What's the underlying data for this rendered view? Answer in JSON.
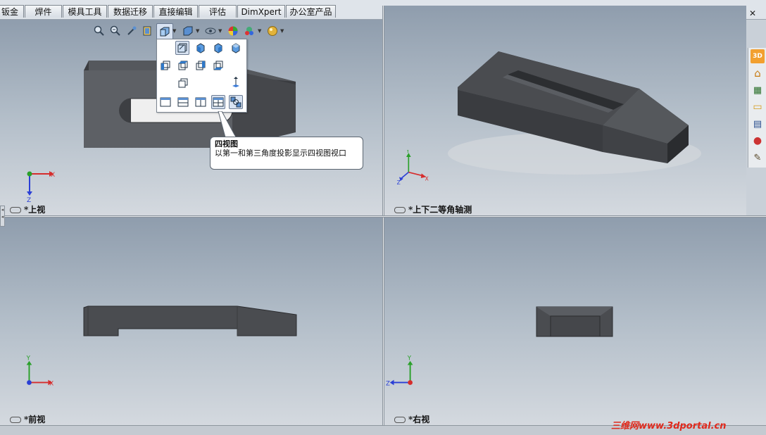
{
  "tabs": [
    {
      "label": "钣金"
    },
    {
      "label": "焊件"
    },
    {
      "label": "模具工具"
    },
    {
      "label": "数据迁移"
    },
    {
      "label": "直接编辑"
    },
    {
      "label": "评估"
    },
    {
      "label": "DimXpert"
    },
    {
      "label": "办公室产品"
    }
  ],
  "window_controls": {
    "minimize": "–",
    "restore": "❐",
    "close": "✕"
  },
  "heads_up_toolbar": [
    {
      "name": "zoom-to-fit-icon",
      "glyph": "🔍"
    },
    {
      "name": "zoom-to-area-icon",
      "glyph": "⊕"
    },
    {
      "name": "previous-view-icon",
      "glyph": "↶"
    },
    {
      "name": "section-view-icon",
      "glyph": "▤"
    },
    {
      "name": "view-orientation-icon",
      "glyph": "▣"
    },
    {
      "name": "display-style-icon",
      "glyph": "◩"
    },
    {
      "name": "hide-show-items-icon",
      "glyph": "👁"
    },
    {
      "name": "edit-appearance-icon",
      "glyph": "●"
    },
    {
      "name": "apply-scene-icon",
      "glyph": "☀"
    },
    {
      "name": "view-settings-icon",
      "glyph": "◉"
    }
  ],
  "flyout": {
    "row1": [
      "normal-to-icon",
      "front-view-icon",
      "back-view-icon",
      "left-view-icon"
    ],
    "row2": [
      "right-view-icon",
      "top-view-icon",
      "bottom-view-icon",
      "isometric-view-icon"
    ],
    "row3": [
      "trimetric-view-icon",
      "dimetric-view-icon"
    ],
    "row4": [
      "single-view-icon",
      "two-view-horizontal-icon",
      "two-view-vertical-icon",
      "four-view-icon",
      "link-views-icon"
    ]
  },
  "tooltip": {
    "title": "四视图",
    "text": "以第一和第三角度投影显示四视图视口"
  },
  "viewports": {
    "top_left": {
      "label": "*上视"
    },
    "top_right": {
      "label": "*上下二等角轴测"
    },
    "bottom_left": {
      "label": "*前视"
    },
    "bottom_right": {
      "label": "*右视"
    }
  },
  "axes": {
    "x": "X",
    "y": "Y",
    "z": "Z"
  },
  "task_pane": [
    {
      "name": "solidworks-resources-icon",
      "glyph": "3D"
    },
    {
      "name": "home-icon",
      "glyph": "⌂"
    },
    {
      "name": "design-library-icon",
      "glyph": "▦"
    },
    {
      "name": "file-explorer-icon",
      "glyph": "▭"
    },
    {
      "name": "view-palette-icon",
      "glyph": "▤"
    },
    {
      "name": "appearances-icon",
      "glyph": "●"
    },
    {
      "name": "custom-properties-icon",
      "glyph": "✎"
    }
  ],
  "watermark": "三维网www.3dportal.cn",
  "colors": {
    "part_fill": "#4a4c50",
    "part_dark": "#333538",
    "part_light": "#6a6d72",
    "axis_x": "#d62c2c",
    "axis_y": "#2aa02a",
    "axis_z": "#2a3fd6",
    "watermark": "#e0291c"
  }
}
